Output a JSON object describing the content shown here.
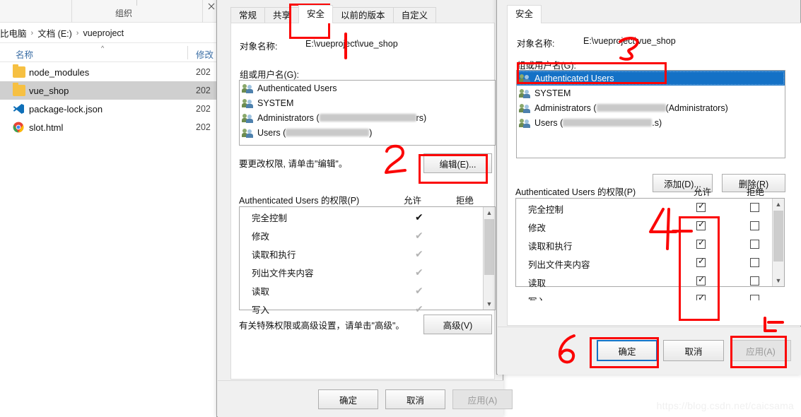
{
  "explorer": {
    "ribbon_label": "组织",
    "breadcrumb": [
      "比电脑",
      "文档 (E:)",
      "vueproject"
    ],
    "columns": {
      "name": "名称",
      "modified": "修改"
    },
    "files": [
      {
        "icon": "folder-icon",
        "name": "node_modules",
        "date": "202",
        "selected": false
      },
      {
        "icon": "folder-icon",
        "name": "vue_shop",
        "date": "202",
        "selected": true
      },
      {
        "icon": "vscode-icon",
        "name": "package-lock.json",
        "date": "202",
        "selected": false
      },
      {
        "icon": "chrome-icon",
        "name": "slot.html",
        "date": "202",
        "selected": false
      }
    ]
  },
  "properties_dialog": {
    "tabs": [
      {
        "label": "常规",
        "active": false
      },
      {
        "label": "共享",
        "active": false
      },
      {
        "label": "安全",
        "active": true
      },
      {
        "label": "以前的版本",
        "active": false
      },
      {
        "label": "自定义",
        "active": false
      }
    ],
    "object_name_label": "对象名称:",
    "object_name_value": "E:\\vueproject\\vue_shop",
    "group_label": "组或用户名(G):",
    "users": [
      {
        "name": "Authenticated Users",
        "redacted": false
      },
      {
        "name": "SYSTEM",
        "redacted": false
      },
      {
        "name": "Administrators (",
        "redacted": true,
        "suffix": "rs)"
      },
      {
        "name": "Users (",
        "redacted": true,
        "suffix": ")"
      }
    ],
    "edit_hint": "要更改权限, 请单击\"编辑\"。",
    "edit_button": "编辑(E)...",
    "perm_title": "Authenticated Users 的权限(P)",
    "allow_col": "允许",
    "deny_col": "拒绝",
    "permissions": [
      {
        "name": "完全控制",
        "allow": "check-dark"
      },
      {
        "name": "修改",
        "allow": "check-gray"
      },
      {
        "name": "读取和执行",
        "allow": "check-gray"
      },
      {
        "name": "列出文件夹内容",
        "allow": "check-gray"
      },
      {
        "name": "读取",
        "allow": "check-gray"
      },
      {
        "name": "写入",
        "allow": "check-gray"
      }
    ],
    "advanced_hint": "有关特殊权限或高级设置，请单击\"高级\"。",
    "advanced_button": "高级(V)",
    "ok_button": "确定",
    "cancel_button": "取消",
    "apply_button": "应用(A)"
  },
  "permissions_dialog": {
    "tab_label": "安全",
    "object_name_label": "对象名称:",
    "object_name_value": "E:\\vueproject\\vue_shop",
    "group_label": "组或用户名(G):",
    "users": [
      {
        "name": "Authenticated Users",
        "selected": true,
        "redacted": false
      },
      {
        "name": "SYSTEM",
        "selected": false,
        "redacted": false
      },
      {
        "name": "Administrators (",
        "selected": false,
        "redacted": true,
        "suffix": "(Administrators)"
      },
      {
        "name": "Users (",
        "selected": false,
        "redacted": true,
        "suffix": ".s)"
      }
    ],
    "add_button": "添加(D)...",
    "remove_button": "删除(R)",
    "perm_title": "Authenticated Users 的权限(P)",
    "allow_col": "允许",
    "deny_col": "拒绝",
    "permissions": [
      {
        "name": "完全控制",
        "allow": true,
        "deny": false
      },
      {
        "name": "修改",
        "allow": true,
        "deny": false
      },
      {
        "name": "读取和执行",
        "allow": true,
        "deny": false
      },
      {
        "name": "列出文件夹内容",
        "allow": true,
        "deny": false
      },
      {
        "name": "读取",
        "allow": true,
        "deny": false
      },
      {
        "name": "写入",
        "allow": true,
        "deny": false
      }
    ],
    "ok_button": "确定",
    "cancel_button": "取消",
    "apply_button": "应用(A)"
  },
  "annotations": {
    "step_2": "2",
    "step_3": "3",
    "step_4": "4",
    "step_6": "6",
    "color": "#fb0505"
  },
  "watermark": "https://blog.csdn.net/caicsama"
}
